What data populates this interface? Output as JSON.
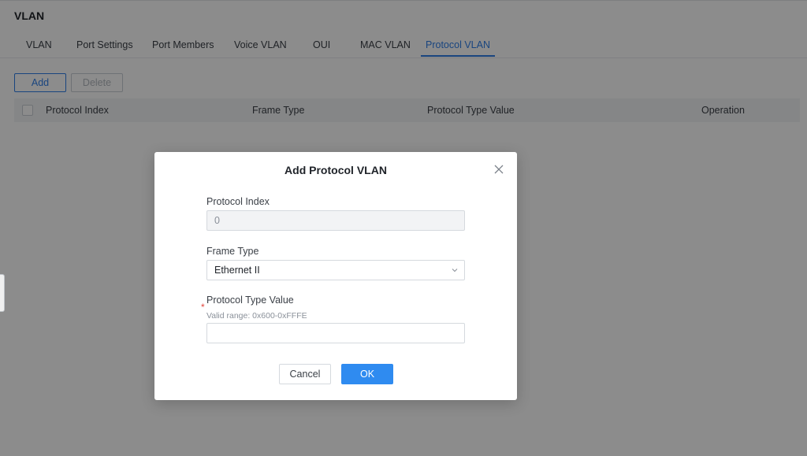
{
  "page": {
    "title": "VLAN",
    "tabs": [
      {
        "label": "VLAN"
      },
      {
        "label": "Port Settings"
      },
      {
        "label": "Port Members"
      },
      {
        "label": "Voice VLAN"
      },
      {
        "label": "OUI"
      },
      {
        "label": "MAC VLAN"
      },
      {
        "label": "Protocol VLAN",
        "active": true
      }
    ],
    "toolbar": {
      "add_label": "Add",
      "delete_label": "Delete"
    },
    "table": {
      "columns": [
        "Protocol Index",
        "Frame Type",
        "Protocol Type Value",
        "Operation"
      ]
    }
  },
  "modal": {
    "title": "Add Protocol VLAN",
    "protocol_index": {
      "label": "Protocol Index",
      "value": "0"
    },
    "frame_type": {
      "label": "Frame Type",
      "value": "Ethernet II"
    },
    "protocol_type_value": {
      "required_mark": "*",
      "label": "Protocol Type Value",
      "hint": "Valid range: 0x600-0xFFFE",
      "value": ""
    },
    "cancel_label": "Cancel",
    "ok_label": "OK"
  },
  "colors": {
    "accent": "#2f7ee8",
    "primary_button": "#2f8bf0",
    "required": "#e2463c"
  },
  "icons": {
    "close": "close-icon",
    "select_arrow": "chevron-down-icon"
  }
}
